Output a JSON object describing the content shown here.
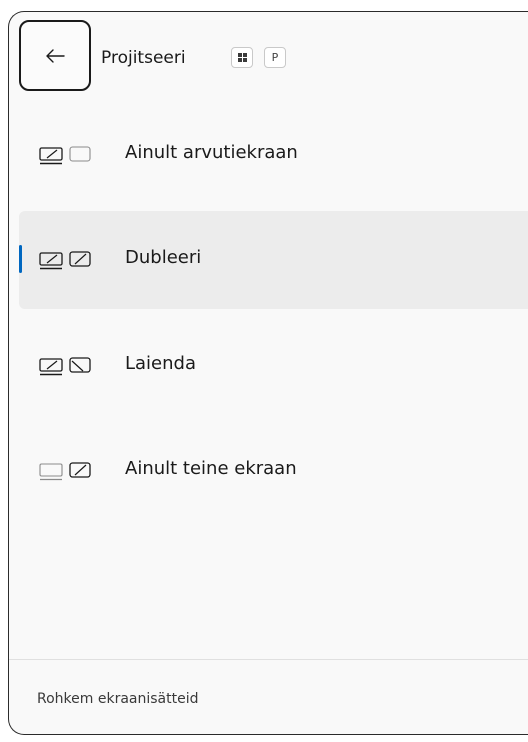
{
  "header": {
    "title": "Projitseeri",
    "shortcut_key": "P"
  },
  "options": [
    {
      "label": "Ainult arvutiekraan",
      "icon": "pc-screen-only-icon",
      "selected": false
    },
    {
      "label": "Dubleeri",
      "icon": "duplicate-icon",
      "selected": true
    },
    {
      "label": "Laienda",
      "icon": "extend-icon",
      "selected": false
    },
    {
      "label": "Ainult teine ekraan",
      "icon": "second-screen-only-icon",
      "selected": false
    }
  ],
  "footer": {
    "link": "Rohkem ekraanisätteid"
  },
  "colors": {
    "accent": "#0067c0",
    "selected_bg": "#ececec",
    "panel_bg": "#f9f9f9"
  }
}
